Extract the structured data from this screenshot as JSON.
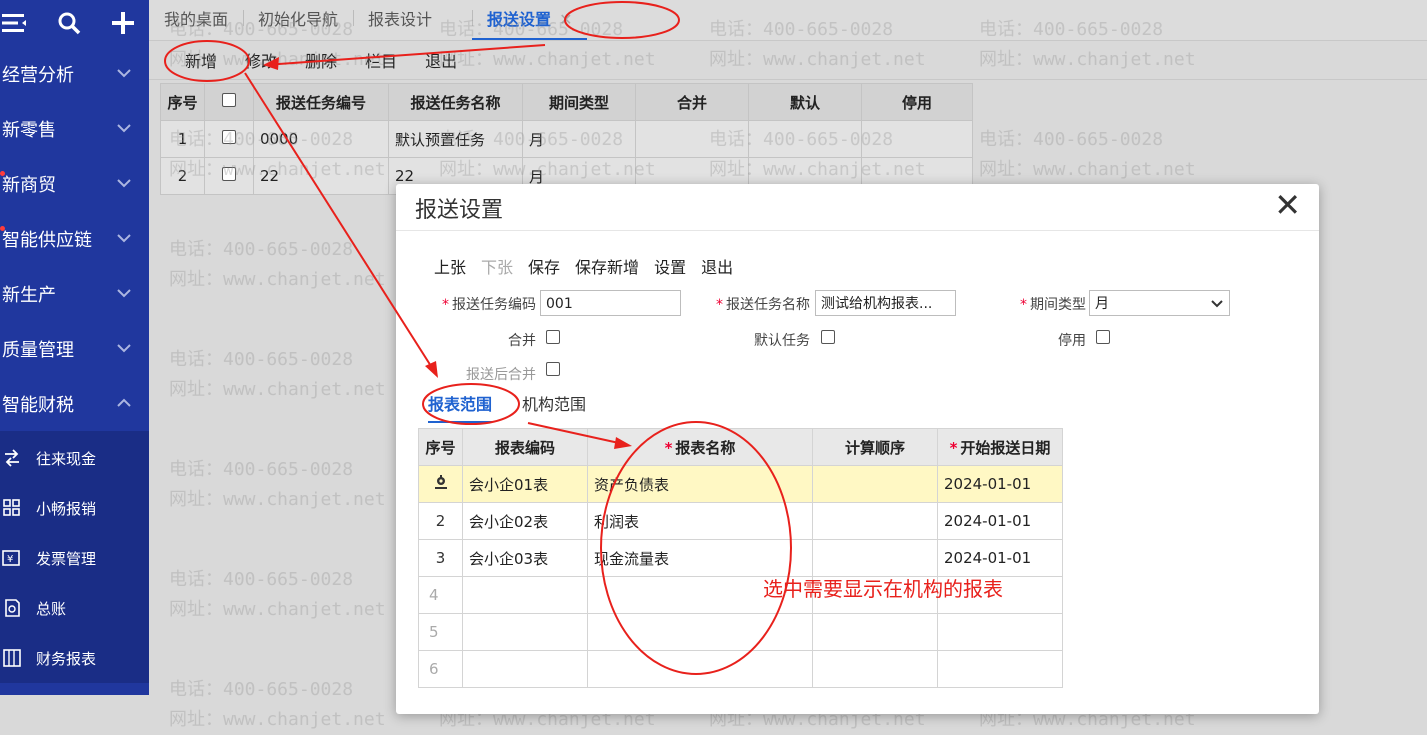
{
  "sidebar": {
    "menu": [
      {
        "label": "经营分析",
        "expanded": false,
        "dot": false
      },
      {
        "label": "新零售",
        "expanded": false,
        "dot": false
      },
      {
        "label": "新商贸",
        "expanded": false,
        "dot": true
      },
      {
        "label": "智能供应链",
        "expanded": false,
        "dot": true
      },
      {
        "label": "新生产",
        "expanded": false,
        "dot": false
      },
      {
        "label": "质量管理",
        "expanded": false,
        "dot": false
      },
      {
        "label": "智能财税",
        "expanded": true,
        "dot": false
      }
    ],
    "submenu": [
      {
        "label": "往来现金",
        "icon": "exchange-icon"
      },
      {
        "label": "小畅报销",
        "icon": "grid-icon"
      },
      {
        "label": "发票管理",
        "icon": "invoice-icon"
      },
      {
        "label": "总账",
        "icon": "ledger-icon"
      },
      {
        "label": "财务报表",
        "icon": "report-icon"
      }
    ]
  },
  "tabs": [
    "我的桌面",
    "初始化导航",
    "报表设计",
    "报送设置"
  ],
  "tab_close": "✕",
  "toolbar": [
    "新增",
    "修改",
    "删除",
    "栏目",
    "退出"
  ],
  "grid": {
    "headers": [
      "序号",
      "",
      "报送任务编号",
      "报送任务名称",
      "期间类型",
      "合并",
      "默认",
      "停用"
    ],
    "rows": [
      {
        "no": "1",
        "code": "0000",
        "name": "默认预置任务",
        "period": "月"
      },
      {
        "no": "2",
        "code": "22",
        "name": "22",
        "period": "月"
      }
    ]
  },
  "watermark": {
    "phone": "电话：400-665-0028",
    "site": "网址：www.chanjet.net"
  },
  "dialog": {
    "title": "报送设置",
    "close": "✕",
    "tools": [
      "上张",
      "下张",
      "保存",
      "保存新增",
      "设置",
      "退出"
    ],
    "fields": {
      "code_label": "报送任务编码",
      "code_value": "001",
      "name_label": "报送任务名称",
      "name_value": "测试给机构报表...",
      "period_label": "期间类型",
      "period_value": "月",
      "merge_label": "合并",
      "default_label": "默认任务",
      "disable_label": "停用",
      "after_merge_label": "报送后合并"
    },
    "subtabs": [
      "报表范围",
      "机构范围"
    ],
    "table": {
      "headers": [
        "序号",
        "报表编码",
        "报表名称",
        "计算顺序",
        "开始报送日期"
      ],
      "rows": [
        {
          "no": "",
          "code": "会小企01表",
          "name": "资产负债表",
          "order": "",
          "date": "2024-01-01"
        },
        {
          "no": "2",
          "code": "会小企02表",
          "name": "利润表",
          "order": "",
          "date": "2024-01-01"
        },
        {
          "no": "3",
          "code": "会小企03表",
          "name": "现金流量表",
          "order": "",
          "date": "2024-01-01"
        },
        {
          "no": "4",
          "code": "",
          "name": "",
          "order": "",
          "date": ""
        },
        {
          "no": "5",
          "code": "",
          "name": "",
          "order": "",
          "date": ""
        },
        {
          "no": "6",
          "code": "",
          "name": "",
          "order": "",
          "date": ""
        }
      ]
    }
  },
  "annotation": {
    "text": "选中需要显示在机构的报表",
    "color": "#e8211c"
  }
}
